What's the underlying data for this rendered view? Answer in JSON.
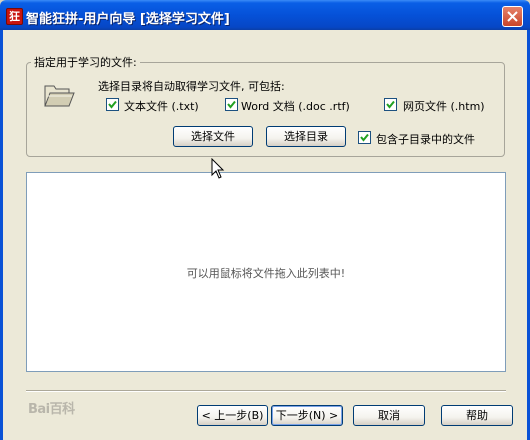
{
  "window": {
    "title": "智能狂拼-用户向导 [选择学习文件]",
    "app_icon_char": "狂"
  },
  "group": {
    "legend": "指定用于学习的文件:",
    "description": "选择目录将自动取得学习文件, 可包括:",
    "file_types": [
      {
        "label": "文本文件 (.txt)",
        "checked": true
      },
      {
        "label": "Word 文档 (.doc .rtf)",
        "checked": true
      },
      {
        "label": "网页文件 (.htm)",
        "checked": true
      }
    ],
    "select_file_button": "选择文件",
    "select_dir_button": "选择目录",
    "include_subdirs": {
      "label": "包含子目录中的文件",
      "checked": true
    }
  },
  "drop_area": {
    "hint": "可以用鼠标将文件拖入此列表中!"
  },
  "footer": {
    "back_button": "< 上一步(B)",
    "next_button": "下一步(N) >",
    "cancel_button": "取消",
    "help_button": "帮助"
  },
  "watermark": "Bai百科",
  "colors": {
    "titlebar": "#0551d8",
    "dialog_bg": "#ece9d8",
    "checkbox_border": "#1c5180",
    "checkmark": "#21a121"
  }
}
